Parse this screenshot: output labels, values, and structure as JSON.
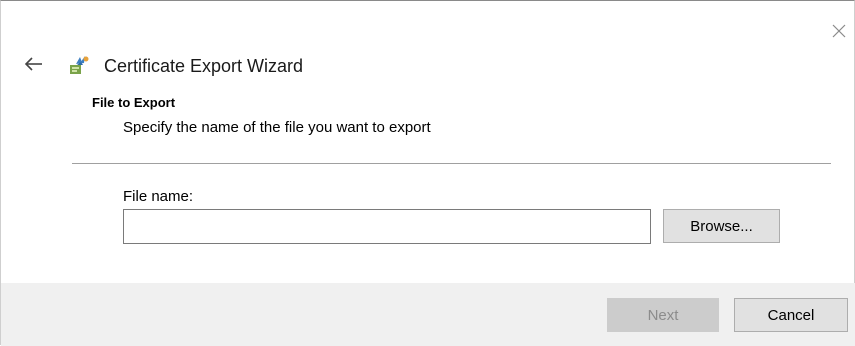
{
  "window": {
    "title": "Certificate Export Wizard",
    "icons": {
      "close": "close-icon",
      "back": "back-arrow-icon",
      "app": "certificate-wizard-icon"
    }
  },
  "section": {
    "title": "File to Export",
    "description": "Specify the name of the file you want to export"
  },
  "form": {
    "file_name_label": "File name:",
    "file_name_value": "",
    "browse_label": "Browse..."
  },
  "footer": {
    "next_label": "Next",
    "next_enabled": false,
    "cancel_label": "Cancel"
  },
  "colors": {
    "footer_bg": "#f0f0f0",
    "button_bg": "#e1e1e1",
    "disabled_button_bg": "#cccccc",
    "disabled_text": "#8c8c8c"
  }
}
